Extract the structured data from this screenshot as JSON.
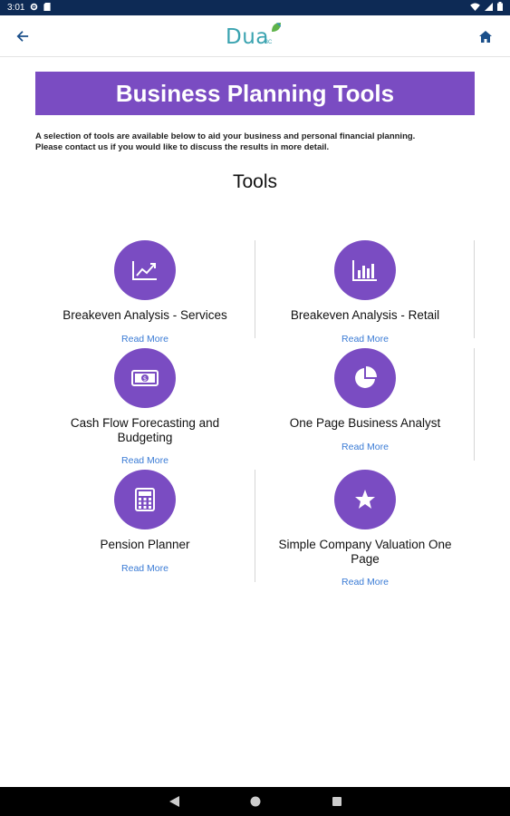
{
  "status_bar": {
    "time": "3:01",
    "icons": [
      "settings-icon",
      "sd-card-icon",
      "wifi-icon",
      "signal-icon",
      "battery-icon"
    ]
  },
  "app_bar": {
    "logo_text": "Dua",
    "logo_subtext": "BC",
    "back_icon": "arrow-back-icon",
    "home_icon": "home-icon"
  },
  "banner": {
    "title": "Business Planning Tools"
  },
  "intro": {
    "line1": "A selection of tools are available below to aid your business and personal financial planning.",
    "line2": "Please contact us if you would like to discuss the results in more detail."
  },
  "section": {
    "heading": "Tools"
  },
  "tools": [
    {
      "title": "Breakeven Analysis - Services",
      "link": "Read More",
      "icon": "line-chart-icon"
    },
    {
      "title": "Breakeven Analysis - Retail",
      "link": "Read More",
      "icon": "bar-chart-icon"
    },
    {
      "title": "Cash Flow Forecasting and Budgeting",
      "link": "Read More",
      "icon": "banknote-icon"
    },
    {
      "title": "One Page Business Analyst",
      "link": "Read More",
      "icon": "pie-chart-icon"
    },
    {
      "title": "Pension Planner",
      "link": "Read More",
      "icon": "calculator-icon"
    },
    {
      "title": "Simple Company Valuation One Page",
      "link": "Read More",
      "icon": "star-icon"
    }
  ],
  "colors": {
    "accent": "#7a4cc2",
    "link": "#3a7bd5",
    "status_bar": "#0d2a55",
    "logo": "#3aa3b0"
  },
  "nav_bar": {
    "icons": [
      "back-triangle-icon",
      "home-circle-icon",
      "recents-square-icon"
    ]
  }
}
